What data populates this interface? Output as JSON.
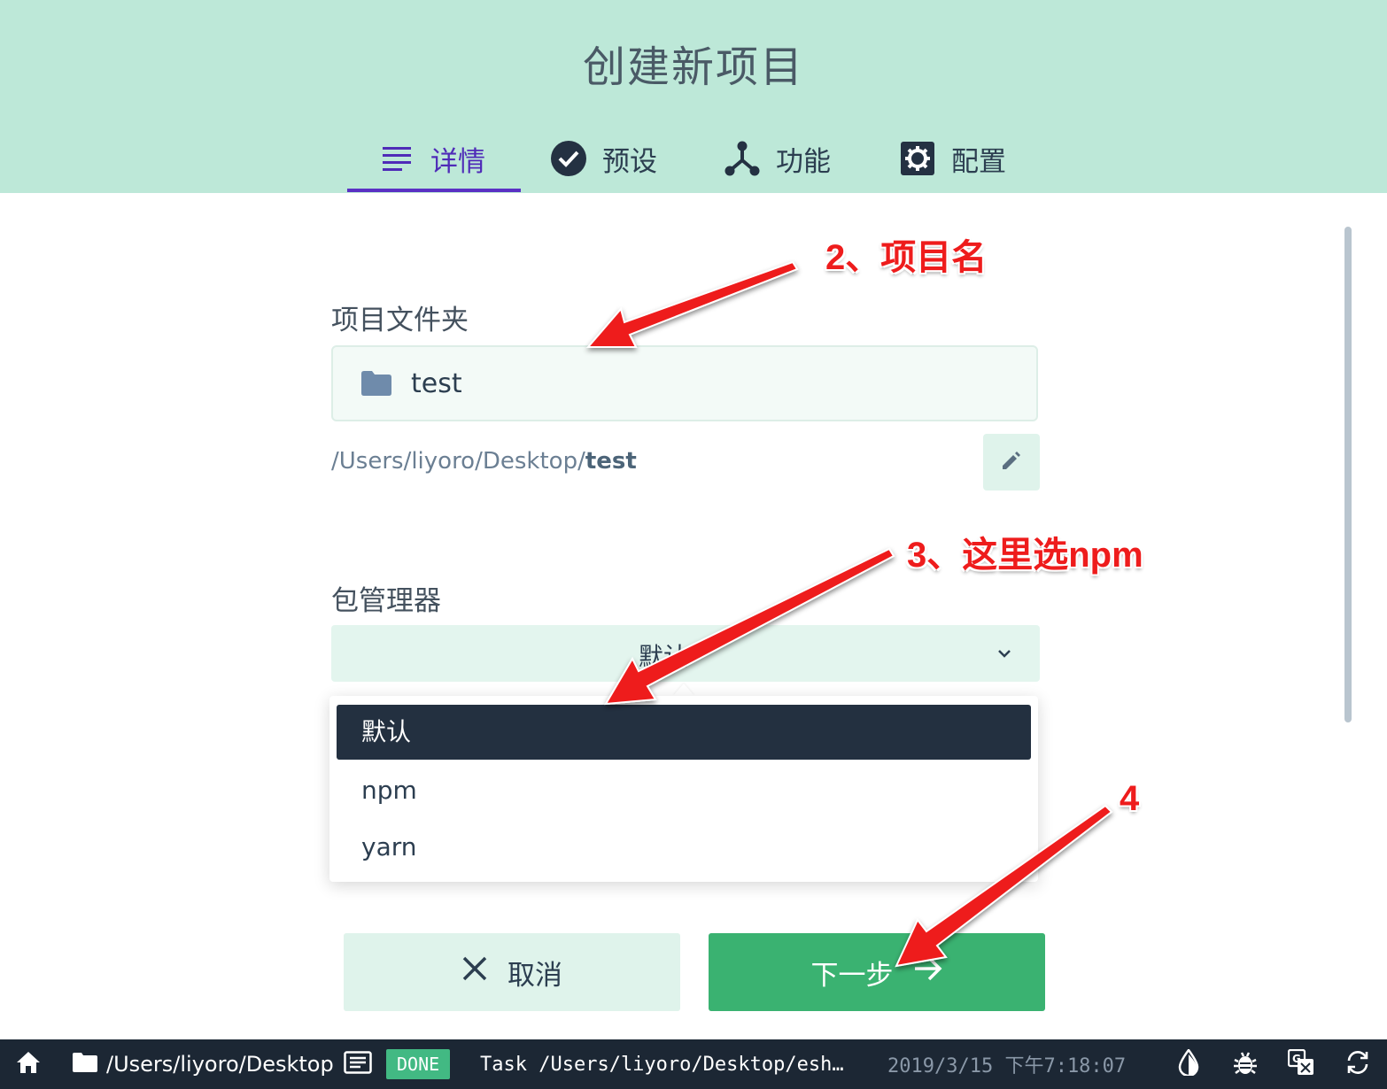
{
  "page": {
    "title": "创建新项目"
  },
  "tabs": [
    {
      "label": "详情",
      "icon": "list-icon",
      "active": true
    },
    {
      "label": "预设",
      "icon": "check-circle-icon",
      "active": false
    },
    {
      "label": "功能",
      "icon": "fork-icon",
      "active": false
    },
    {
      "label": "配置",
      "icon": "gear-icon",
      "active": false
    }
  ],
  "form": {
    "folder_label": "项目文件夹",
    "folder_value": "test",
    "path_prefix": "/Users/liyoro/Desktop/",
    "path_name": "test",
    "package_manager_label": "包管理器",
    "package_manager_value": "默认",
    "options": [
      "默认",
      "npm",
      "yarn"
    ],
    "selected_option": "默认"
  },
  "buttons": {
    "cancel": "取消",
    "next": "下一步"
  },
  "statusbar": {
    "cwd": "/Users/liyoro/Desktop",
    "badge": "DONE",
    "task": "Task /Users/liyoro/Desktop/esh…",
    "timestamp": "2019/3/15 下午7:18:07"
  },
  "annotations": {
    "step2": "2、项目名",
    "step3": "3、这里选npm",
    "step4": "4"
  },
  "colors": {
    "header_bg": "#bde8d8",
    "accent_purple": "#5a31c4",
    "primary_green": "#3ab271",
    "statusbar_bg": "#1c2734",
    "annotation_red": "#ee1c1c"
  }
}
